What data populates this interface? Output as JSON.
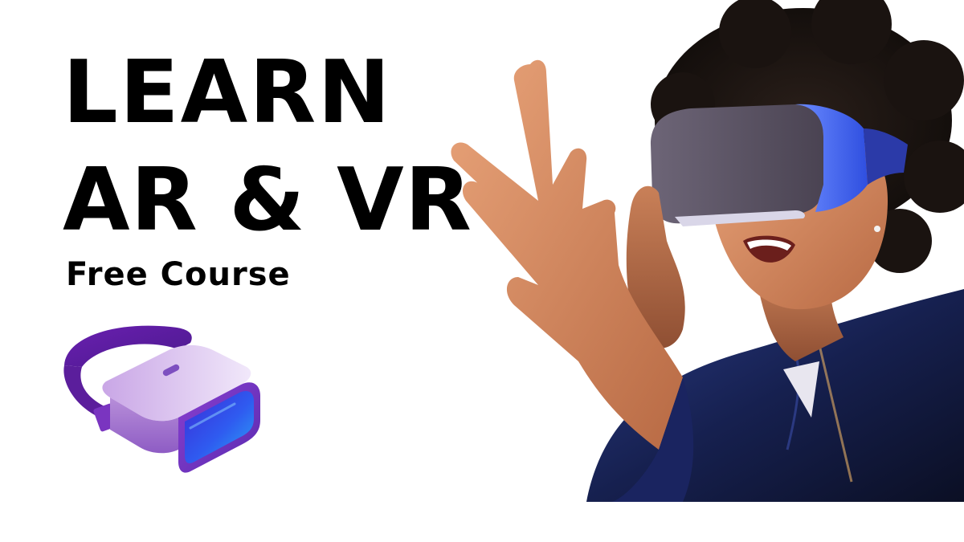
{
  "hero": {
    "title_line_1": "LEARN",
    "title_line_2": "AR & VR",
    "subtitle": "Free Course"
  },
  "icons": {
    "headset_illustration": "vr-headset-icon"
  },
  "colors": {
    "text": "#000000",
    "background": "#ffffff",
    "icon_purple": "#7b2fb8",
    "icon_blue": "#2a3fe0",
    "headset_glow": "#2f5bff"
  }
}
